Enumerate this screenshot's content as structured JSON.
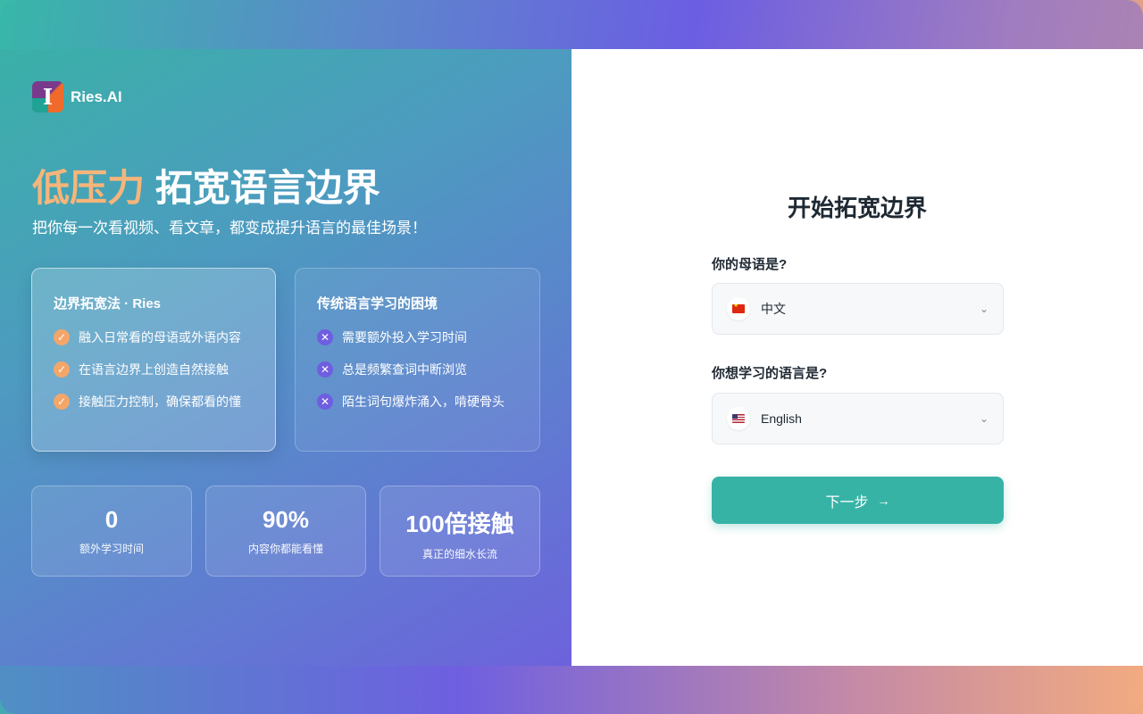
{
  "brand": {
    "name": "Ries.AI",
    "logo_letter": "I"
  },
  "hero": {
    "headline_accent": "低压力",
    "headline_rest": "拓宽语言边界",
    "subheadline": "把你每一次看视频、看文章，都变成提升语言的最佳场景！"
  },
  "cards": [
    {
      "title": "边界拓宽法 · Ries",
      "icon": "check-icon",
      "items": [
        "融入日常看的母语或外语内容",
        "在语言边界上创造自然接触",
        "接触压力控制，确保都看的懂"
      ]
    },
    {
      "title": "传统语言学习的困境",
      "icon": "cross-icon",
      "items": [
        "需要额外投入学习时间",
        "总是频繁查词中断浏览",
        "陌生词句爆炸涌入，啃硬骨头"
      ]
    }
  ],
  "stats": [
    {
      "value": "0",
      "label": "额外学习时间"
    },
    {
      "value": "90%",
      "label": "内容你都能看懂"
    },
    {
      "value": "100倍接触",
      "label": "真正的细水长流"
    }
  ],
  "form": {
    "title": "开始拓宽边界",
    "native_label": "你的母语是?",
    "native_value": "中文",
    "native_flag": "flag-cn",
    "target_label": "你想学习的语言是?",
    "target_value": "English",
    "target_flag": "flag-us",
    "next_label": "下一步",
    "next_arrow": "→"
  },
  "colors": {
    "accent": "#f6b57a",
    "primary": "#37b3a6",
    "cross": "#6f5ee0",
    "check": "#f4a669"
  }
}
